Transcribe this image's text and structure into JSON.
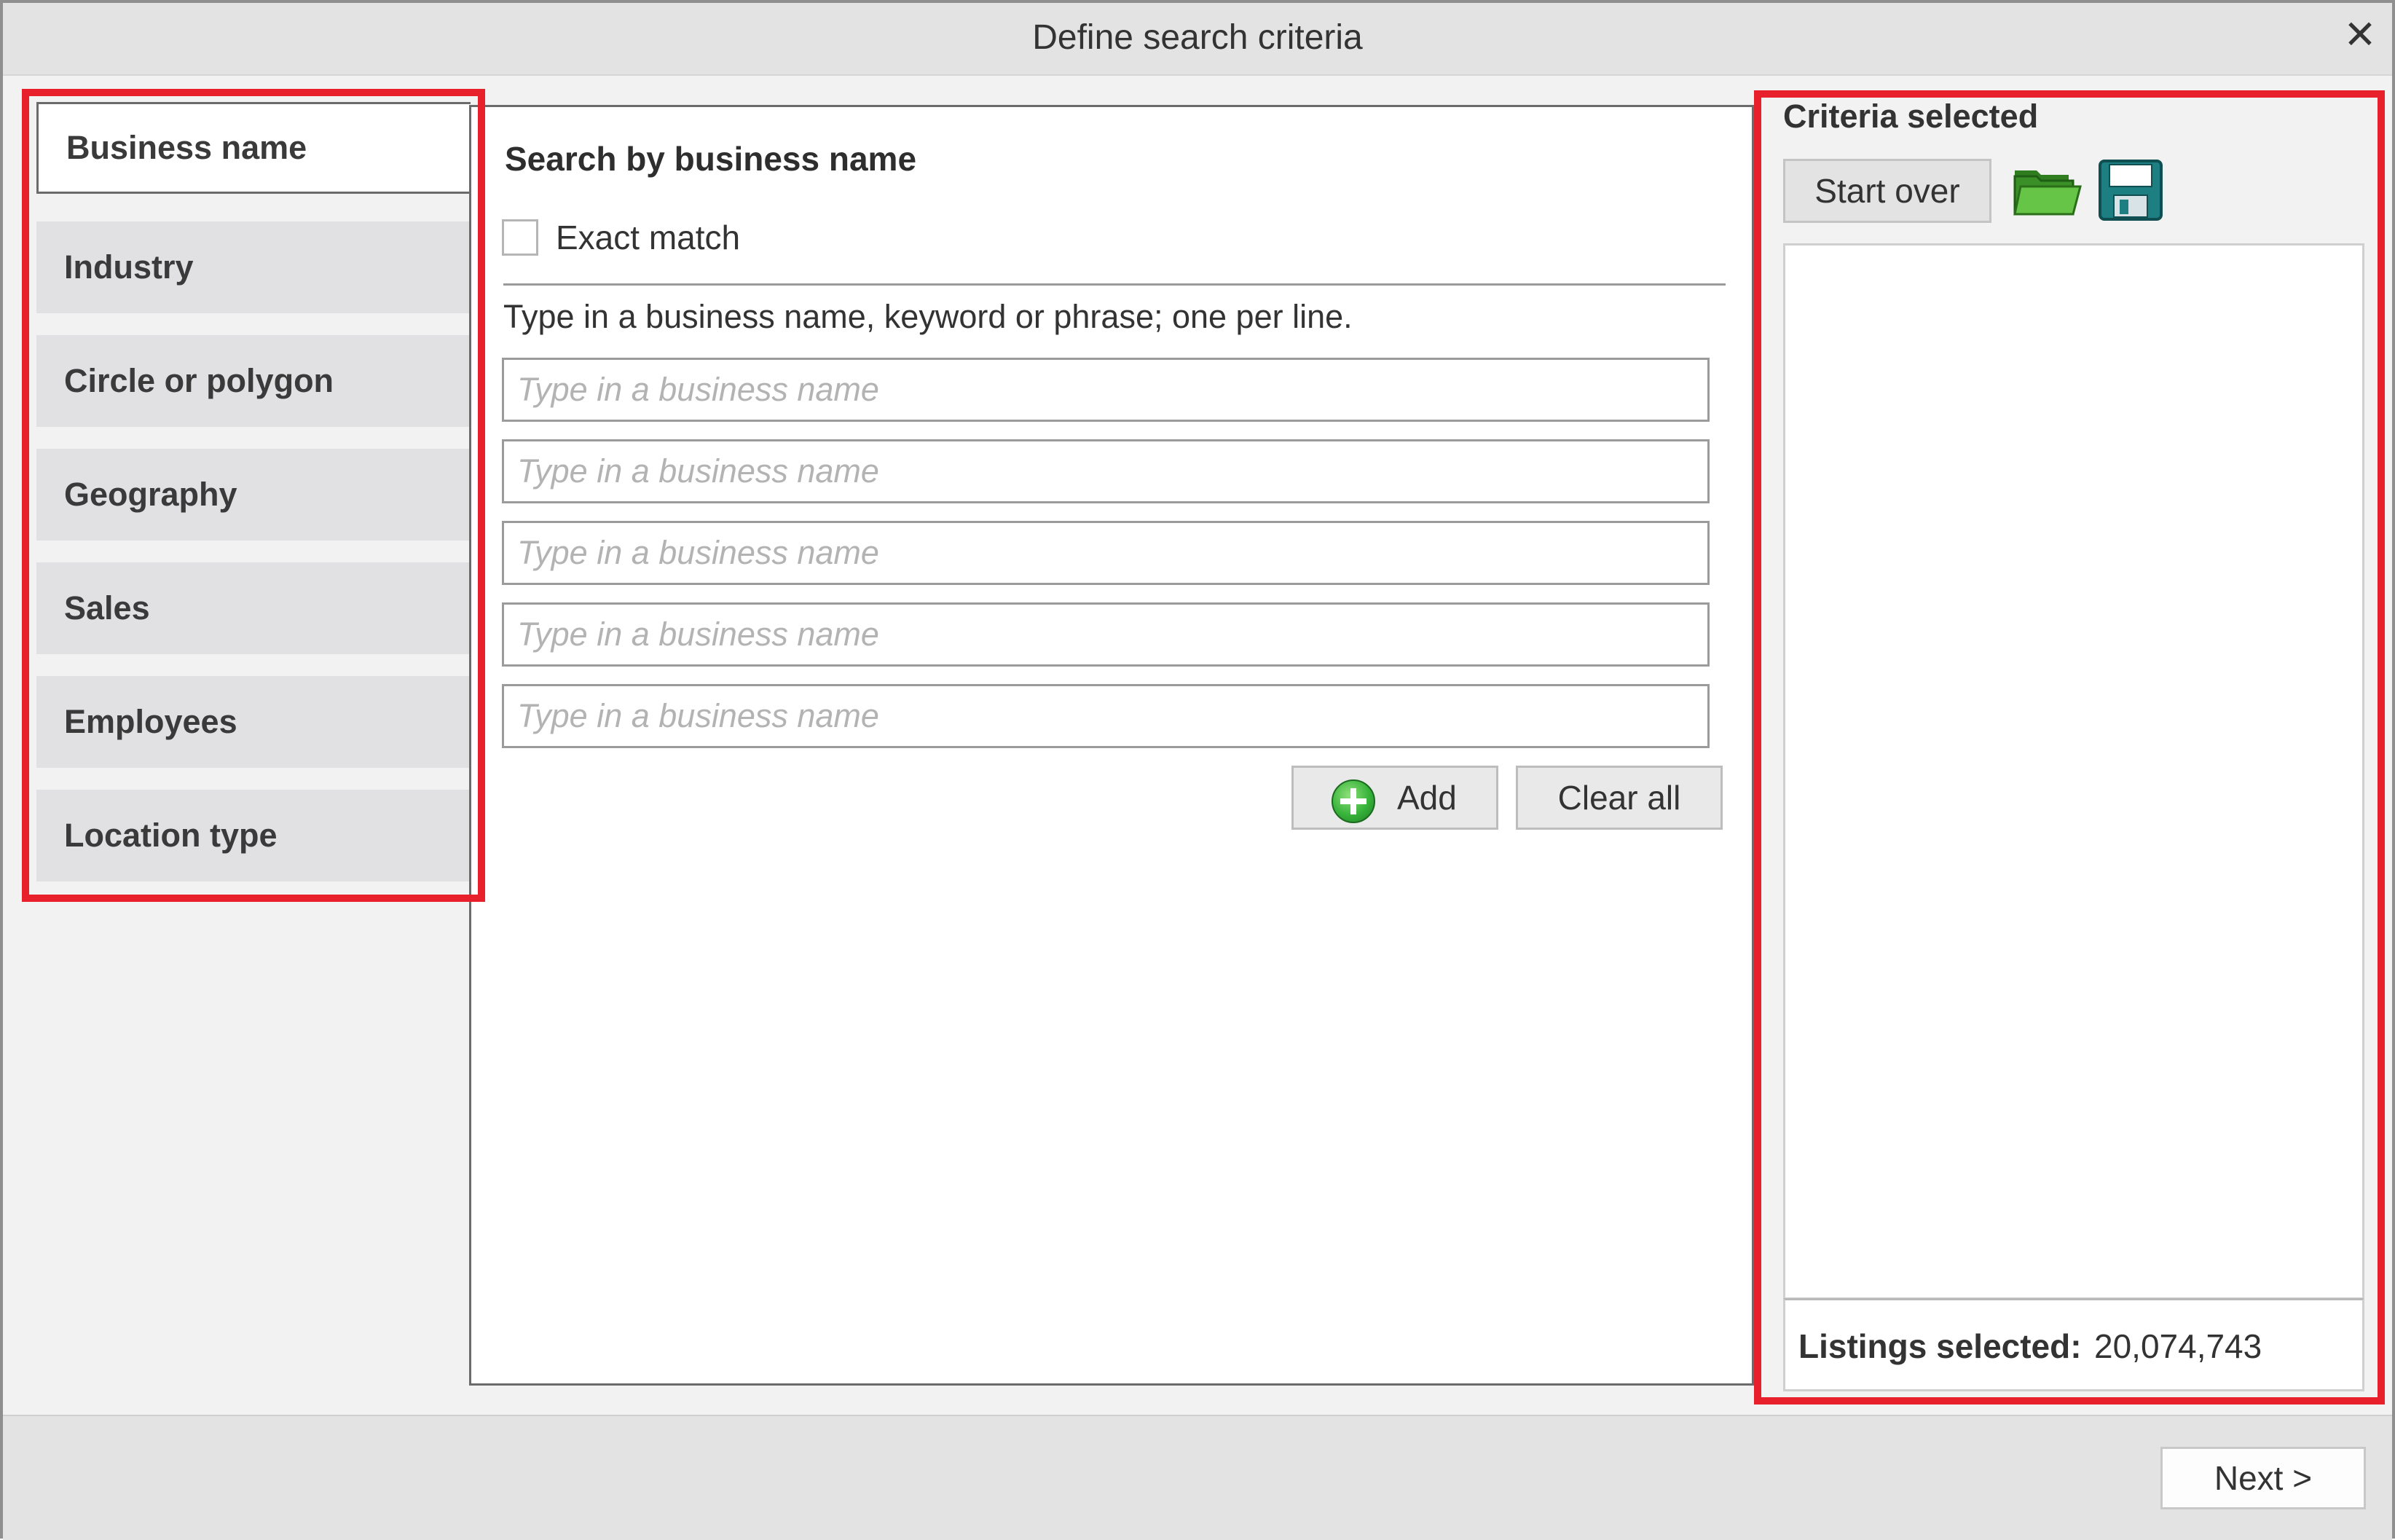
{
  "window": {
    "title": "Define search criteria",
    "close_glyph": "✕"
  },
  "nav": {
    "items": [
      {
        "label": "Business name",
        "active": true
      },
      {
        "label": "Industry",
        "active": false
      },
      {
        "label": "Circle or polygon",
        "active": false
      },
      {
        "label": "Geography",
        "active": false
      },
      {
        "label": "Sales",
        "active": false
      },
      {
        "label": "Employees",
        "active": false
      },
      {
        "label": "Location type",
        "active": false
      }
    ]
  },
  "main": {
    "heading": "Search by business name",
    "exact_match_label": "Exact match",
    "exact_match_checked": false,
    "instructions": "Type in a business name, keyword or phrase; one per line.",
    "inputs": [
      {
        "value": "",
        "placeholder": "Type in a business name"
      },
      {
        "value": "",
        "placeholder": "Type in a business name"
      },
      {
        "value": "",
        "placeholder": "Type in a business name"
      },
      {
        "value": "",
        "placeholder": "Type in a business name"
      },
      {
        "value": "",
        "placeholder": "Type in a business name"
      }
    ],
    "add_label": "Add",
    "clear_label": "Clear all"
  },
  "criteria": {
    "title": "Criteria selected",
    "start_over_label": "Start over",
    "listings_label": "Listings selected:",
    "listings_count": "20,074,743"
  },
  "footer": {
    "next_label": "Next >"
  },
  "colors": {
    "highlight": "#e8202c",
    "accent_green": "#37b33a",
    "save_teal": "#1d7f82"
  },
  "icons": [
    "close-icon",
    "plus-circle-icon",
    "open-folder-icon",
    "save-disk-icon"
  ]
}
